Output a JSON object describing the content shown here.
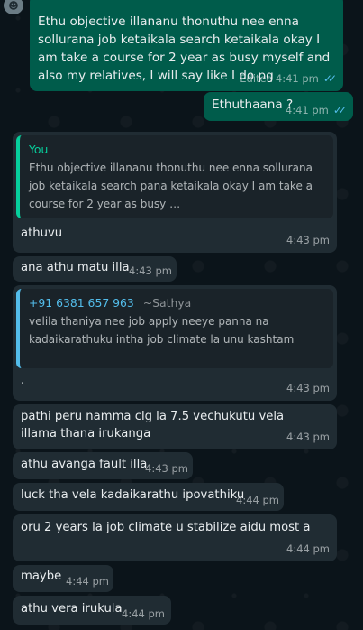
{
  "messages": [
    {
      "id": "m1",
      "text": "Ethu objective illananu thonuthu nee enna sollurana job ketaikala search ketaikala okay I am take a course for 2 year as busy myself and also my relatives, I will say like I do pg",
      "edited": "Edited",
      "time": "4:41 pm"
    },
    {
      "id": "m2",
      "text": "Ethuthaana ?",
      "time": "4:41 pm"
    },
    {
      "id": "m3",
      "quote_author": "You",
      "quote_text": "Ethu objective illananu thonuthu nee enna sollurana job ketaikala search pana ketaikala okay I am take a course for 2 year as busy …",
      "text": "athuvu",
      "time": "4:43 pm"
    },
    {
      "id": "m4",
      "text": "ana athu matu illa",
      "time": "4:43 pm"
    },
    {
      "id": "m5",
      "quote_author": "+91 6381 657 963",
      "quote_name": "~Sathya",
      "quote_text": "velila thaniya nee job apply neeye panna na kadaikarathuku intha job  climate la unu kashtam",
      "text": ".",
      "time": "4:43 pm"
    },
    {
      "id": "m6",
      "text": "pathi peru namma clg la 7.5 vechukutu vela illama thana irukanga",
      "time": "4:43 pm"
    },
    {
      "id": "m7",
      "text": "athu avanga fault illa",
      "time": "4:43 pm"
    },
    {
      "id": "m8",
      "text": "luck tha vela kadaikarathu ipovathiku",
      "time": "4:44 pm"
    },
    {
      "id": "m9",
      "text": "oru 2 years la job climate u stabilize aidu most a",
      "time": "4:44 pm"
    },
    {
      "id": "m10",
      "text": "maybe",
      "time": "4:44 pm"
    },
    {
      "id": "m11",
      "text": "athu vera irukula",
      "time": "4:44 pm"
    }
  ],
  "colors": {
    "outgoing": "#005c4b",
    "incoming": "#202c33",
    "you_accent": "#06cf9c",
    "other_accent": "#53bdeb",
    "ticks": "#53bdeb"
  },
  "icons": {
    "read": "double-check-icon",
    "avatar": "avatar-icon"
  }
}
